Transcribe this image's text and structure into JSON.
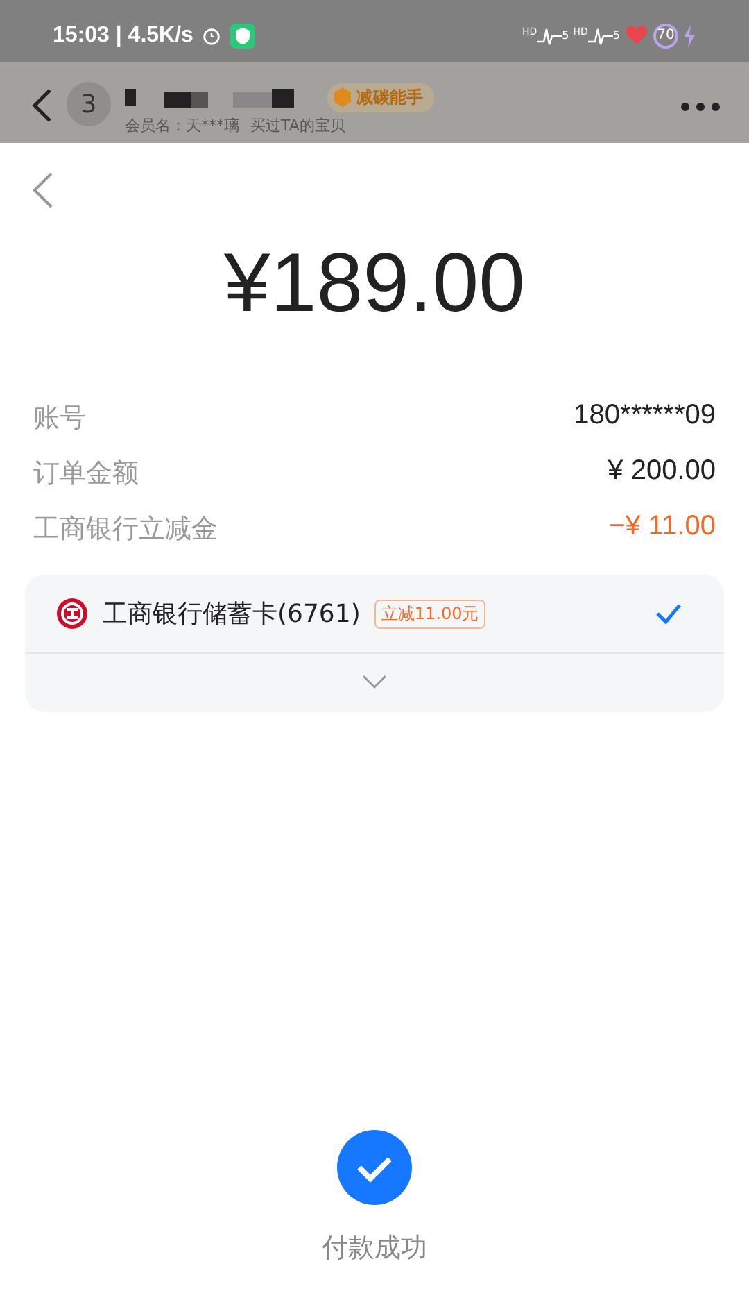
{
  "status_bar": {
    "time": "15:03 | 4.5K/s",
    "sims": [
      {
        "label": "HD",
        "number": "5"
      },
      {
        "label": "HD",
        "number": "5"
      }
    ],
    "battery": "70"
  },
  "chat_header": {
    "unread": "3",
    "tag": "减碳能手",
    "member": "会员名：天***璃",
    "link": "买过TA的宝贝"
  },
  "payment": {
    "amount": "¥189.00",
    "rows": [
      {
        "label": "账号",
        "value": "180******09",
        "kind": "plain"
      },
      {
        "label": "订单金额",
        "value": "¥ 200.00",
        "kind": "plain"
      },
      {
        "label": "工商银行立减金",
        "value": "−¥ 11.00",
        "kind": "discount"
      }
    ],
    "methods": [
      {
        "name": "工商银行储蓄卡(6761)",
        "tag": "立减11.00元",
        "selected": true
      }
    ],
    "status": "付款成功"
  }
}
